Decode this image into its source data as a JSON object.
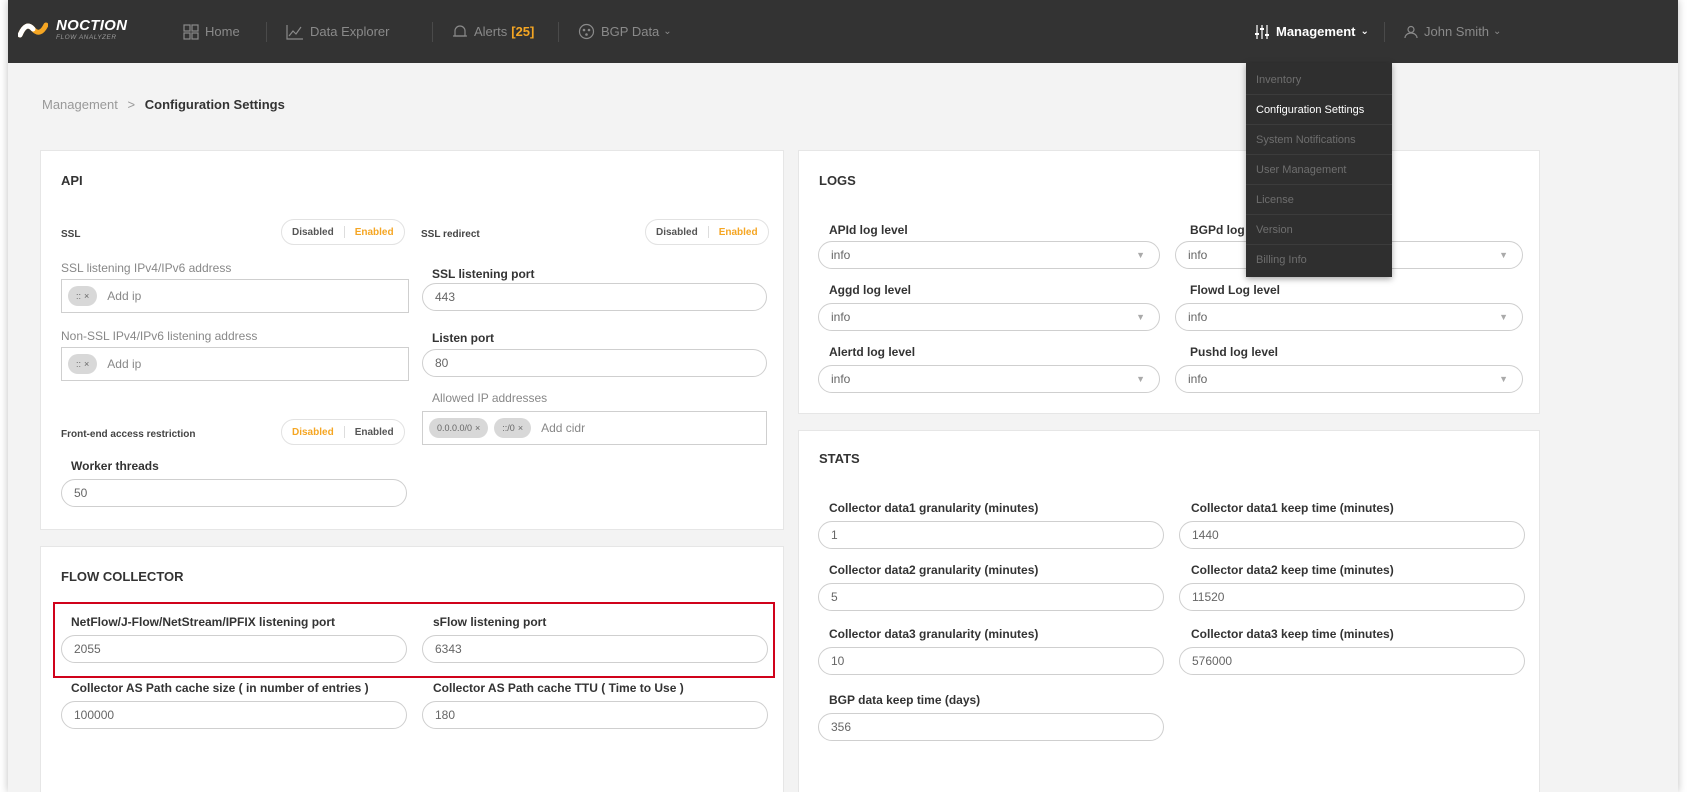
{
  "app": {
    "logo_main": "NOCTION",
    "logo_sub": "FLOW ANALYZER"
  },
  "nav": {
    "home": "Home",
    "data_explorer": "Data Explorer",
    "alerts": "Alerts",
    "alerts_count": "[25]",
    "bgp_data": "BGP Data",
    "management": "Management",
    "user": "John Smith"
  },
  "breadcrumb": {
    "parent": "Management",
    "separator": ">",
    "current": "Configuration Settings"
  },
  "dropdown": {
    "items": [
      "Inventory",
      "Configuration Settings",
      "System Notifications",
      "User Management",
      "License",
      "Version",
      "Billing Info"
    ],
    "active_index": 1
  },
  "api": {
    "title": "API",
    "ssl_label": "SSL",
    "ssl_redirect_label": "SSL redirect",
    "disabled": "Disabled",
    "enabled": "Enabled",
    "ssl_listen_addr_label": "SSL listening IPv4/IPv6 address",
    "ssl_listen_chip": "::",
    "add_ip": "Add ip",
    "ssl_port_label": "SSL listening port",
    "ssl_port": "443",
    "nonssl_addr_label": "Non-SSL IPv4/IPv6 listening address",
    "nonssl_chip": "::",
    "listen_port_label": "Listen port",
    "listen_port": "80",
    "allowed_ip_label": "Allowed IP addresses",
    "allowed_chip_1": "0.0.0.0/0",
    "allowed_chip_2": "::/0",
    "add_cidr": "Add cidr",
    "frontend_label": "Front-end access restriction",
    "worker_threads_label": "Worker threads",
    "worker_threads": "50"
  },
  "flow": {
    "title": "FLOW COLLECTOR",
    "netflow_label": "NetFlow/J-Flow/NetStream/IPFIX listening port",
    "netflow_port": "2055",
    "sflow_label": "sFlow listening port",
    "sflow_port": "6343",
    "as_cache_size_label": "Collector AS Path cache size ( in number of entries )",
    "as_cache_size": "100000",
    "as_cache_ttu_label": "Collector AS Path cache TTU ( Time to Use )",
    "as_cache_ttu": "180"
  },
  "logs": {
    "title": "LOGS",
    "apid_label": "APId log level",
    "apid": "info",
    "bgpd_label": "BGPd log",
    "bgpd": "info",
    "aggd_label": "Aggd log level",
    "aggd": "info",
    "flowd_label": "Flowd Log level",
    "flowd": "info",
    "alertd_label": "Alertd log level",
    "alertd": "info",
    "pushd_label": "Pushd log level",
    "pushd": "info"
  },
  "stats": {
    "title": "STATS",
    "d1_gran_label": "Collector data1 granularity (minutes)",
    "d1_gran": "1",
    "d1_keep_label": "Collector data1 keep time (minutes)",
    "d1_keep": "1440",
    "d2_gran_label": "Collector data2 granularity (minutes)",
    "d2_gran": "5",
    "d2_keep_label": "Collector data2 keep time (minutes)",
    "d2_keep": "11520",
    "d3_gran_label": "Collector data3 granularity (minutes)",
    "d3_gran": "10",
    "d3_keep_label": "Collector data3 keep time (minutes)",
    "d3_keep": "576000",
    "bgp_keep_label": "BGP data keep time (days)",
    "bgp_keep": "356"
  },
  "colors": {
    "accent": "#f5a623",
    "topbar": "#333333",
    "highlight": "#d0021b"
  }
}
